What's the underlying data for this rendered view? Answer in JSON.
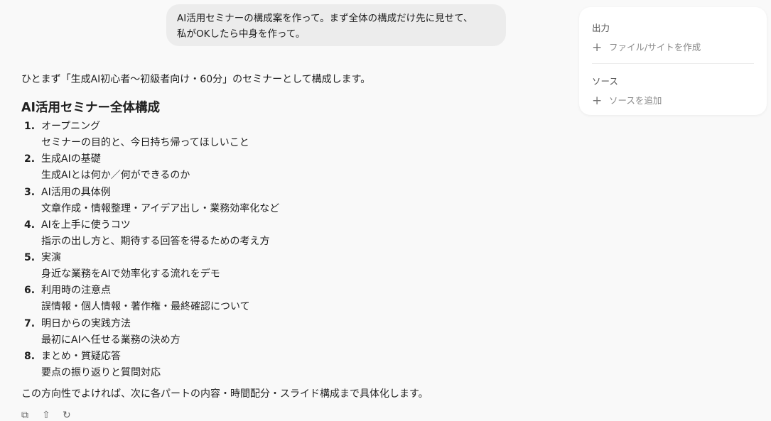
{
  "user_message": {
    "lines": [
      "AI活用セミナーの構成案を作って。まず全体の構成だけ先に見せて、",
      "私がOKしたら中身を作って。"
    ]
  },
  "answer": {
    "intro": "ひとまず「生成AI初心者〜初級者向け・60分」のセミナーとして構成します。",
    "heading": "AI活用セミナー全体構成",
    "outline": [
      {
        "num": "1.",
        "title": "オープニング",
        "desc": "セミナーの目的と、今日持ち帰ってほしいこと"
      },
      {
        "num": "2.",
        "title": "生成AIの基礎",
        "desc": "生成AIとは何か／何ができるのか"
      },
      {
        "num": "3.",
        "title": "AI活用の具体例",
        "desc": "文章作成・情報整理・アイデア出し・業務効率化など"
      },
      {
        "num": "4.",
        "title": "AIを上手に使うコツ",
        "desc": "指示の出し方と、期待する回答を得るための考え方"
      },
      {
        "num": "5.",
        "title": "実演",
        "desc": "身近な業務をAIで効率化する流れをデモ"
      },
      {
        "num": "6.",
        "title": "利用時の注意点",
        "desc": "誤情報・個人情報・著作権・最終確認について"
      },
      {
        "num": "7.",
        "title": "明日からの実践方法",
        "desc": "最初にAIへ任せる業務の決め方"
      },
      {
        "num": "8.",
        "title": "まとめ・質疑応答",
        "desc": "要点の振り返りと質問対応"
      }
    ],
    "closing": "この方向性でよければ、次に各パートの内容・時間配分・スライド構成まで具体化します。"
  },
  "actions": {
    "copy_icon": "⧉",
    "share_icon": "⇧",
    "retry_icon": "↻"
  },
  "side_panel": {
    "output_label": "出力",
    "output_action": "ファイル/サイトを作成",
    "sources_label": "ソース",
    "sources_action": "ソースを追加",
    "plus_icon": "+"
  }
}
